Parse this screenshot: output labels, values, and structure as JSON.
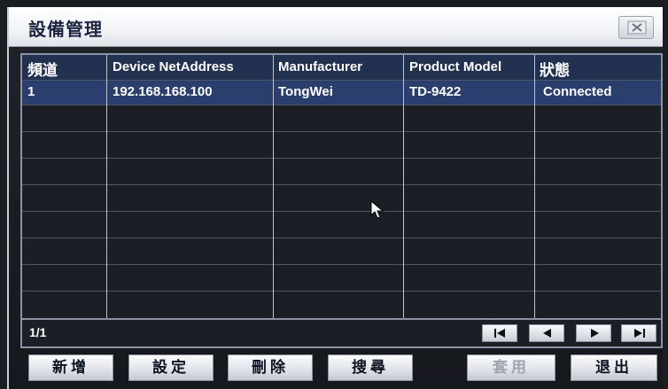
{
  "window": {
    "title": "設備管理"
  },
  "table": {
    "columns": [
      "頻道",
      "Device NetAddress",
      "Manufacturer",
      "Product Model",
      "狀態"
    ],
    "rows": [
      [
        "1",
        "192.168.168.100",
        "TongWei",
        "TD-9422",
        "Connected"
      ]
    ]
  },
  "footer": {
    "page": "1/1"
  },
  "buttons": {
    "add": "新增",
    "settings": "設定",
    "delete": "刪除",
    "search": "搜尋",
    "apply": "套用",
    "exit": "退出"
  },
  "icons": {
    "close": "close-icon",
    "first": "first-page-icon",
    "prev": "prev-page-icon",
    "next": "next-page-icon",
    "last": "last-page-icon",
    "cursor": "mouse-cursor-icon"
  },
  "colors": {
    "header_bg": "#22314f",
    "selected_row": "#2a3f6e",
    "grid": "#4f5666",
    "text": "#ffffff"
  }
}
